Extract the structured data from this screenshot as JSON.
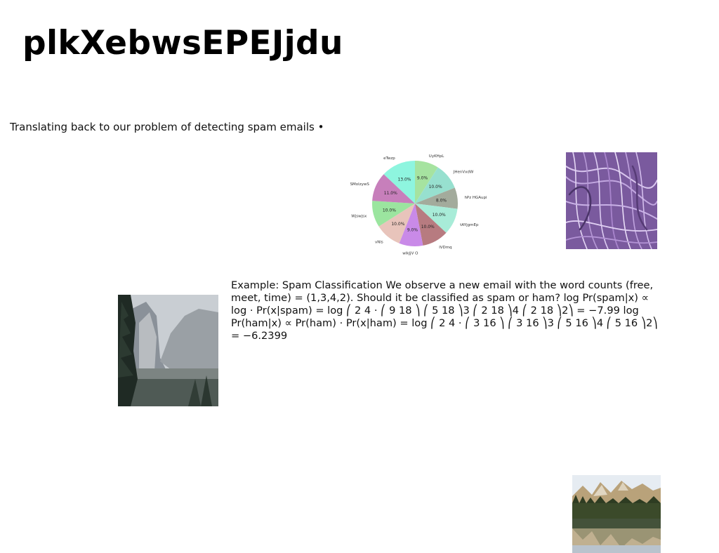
{
  "page": {
    "title": "plkXebwsEPEJjdu",
    "intro_text": "Translating back to our problem of detecting spam emails •",
    "example_text": "Example: Spam Classification We observe a new email with the word counts (free, meet, time) = (1,3,4,2). Should it be classified as spam or ham? log Pr(spam|x) ∝ log · Pr(x|spam) = log ⎛ 2 4 · ⎛ 9 18 ⎞ ⎛ 5 18 ⎞3 ⎛ 2 18 ⎞4 ⎛ 2 18 ⎞2⎞ = −7.99 log Pr(ham|x) ∝ Pr(ham) · Pr(x|ham) = log ⎛ 2 4 · ⎛ 3 16 ⎞ ⎛ 3 16 ⎞3 ⎛ 5 16 ⎞4 ⎛ 5 16 ⎞2⎞ = −6.2399"
  },
  "images": {
    "fibers": "purple-fibers-image",
    "valley": "misty-valley-image",
    "lake": "mountain-lake-image"
  },
  "chart_data": {
    "type": "pie",
    "title": "",
    "slices": [
      {
        "label": "UyKHpL",
        "value": 9.0,
        "color": "#a6e3a0"
      },
      {
        "label": "JHenVxdW",
        "value": 10.0,
        "color": "#97e0cf"
      },
      {
        "label": "hPz HGAupi",
        "value": 8.0,
        "color": "#a3ab9c"
      },
      {
        "label": "tAYjgmEp",
        "value": 10.0,
        "color": "#a8ecd8"
      },
      {
        "label": "lVDmq",
        "value": 10.0,
        "color": "#b77b80"
      },
      {
        "label": "wlkJjV O",
        "value": 9.0,
        "color": "#c98ae8"
      },
      {
        "label": "vNls",
        "value": 10.0,
        "color": "#e8c4bb"
      },
      {
        "label": "Wjswjsx",
        "value": 10.0,
        "color": "#9be59f"
      },
      {
        "label": "SMolzywS",
        "value": 11.0,
        "color": "#c77fbb"
      },
      {
        "label": "eTwzp",
        "value": 13.0,
        "color": "#8ef5df"
      }
    ],
    "pct_labels": [
      "9.0%",
      "10.0%",
      "8.0%",
      "10.0%",
      "10.0%",
      "9.0%",
      "10.0%",
      "10.0%",
      "11.0%",
      "13.0%"
    ]
  }
}
